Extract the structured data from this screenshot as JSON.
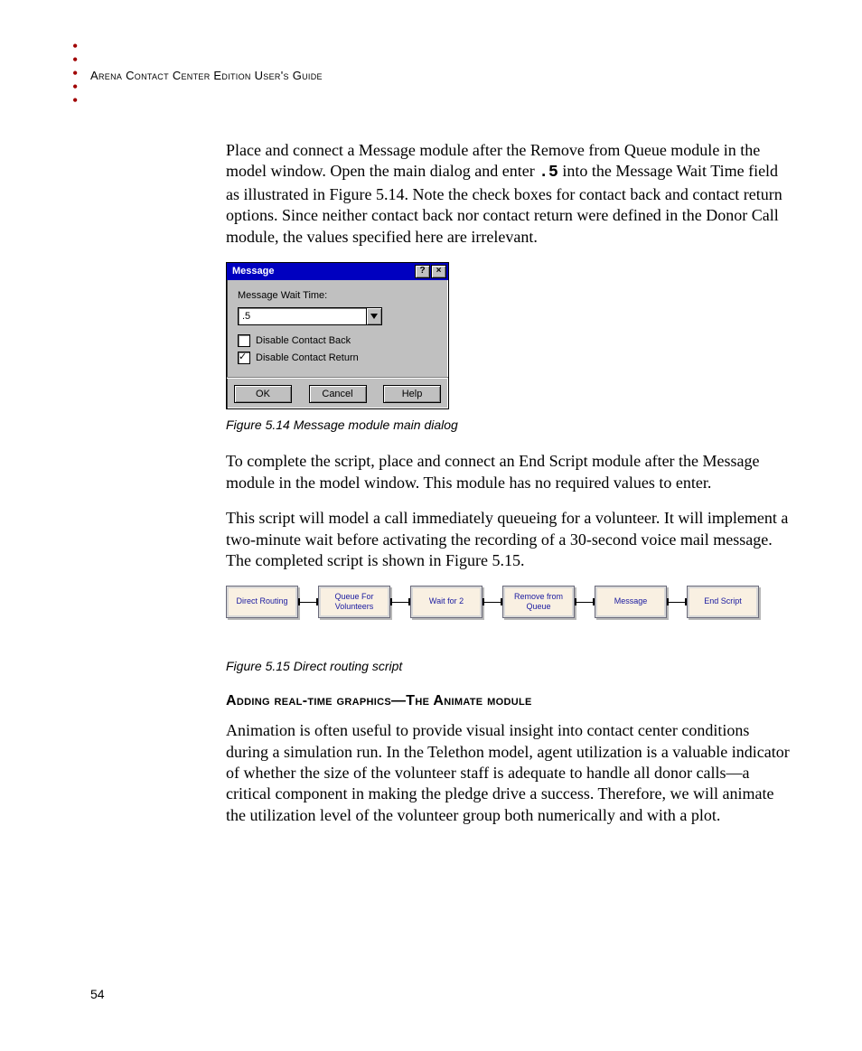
{
  "header": "Arena Contact Center Edition User's Guide",
  "page_number": "54",
  "paragraphs": {
    "p1_a": "Place and connect a Message module after the Remove from Queue module in the model window. Open the main dialog and enter ",
    "p1_code": ".5",
    "p1_b": " into the Message Wait Time field as illustrated in Figure 5.14. Note the check boxes for contact back and contact return options.  Since neither contact back nor contact return were defined in the Donor Call module, the values specified here are irrelevant.",
    "p2": "To complete the script, place and connect an End Script module after the Message module in the model window. This module has no required values to enter.",
    "p3": "This script will model a call immediately queueing for a volunteer. It will implement a two-minute wait before activating the recording of a 30-second voice mail message. The completed script is shown in Figure 5.15.",
    "p4": "Animation is often useful to provide visual insight into contact center conditions during a simulation run. In the Telethon model, agent utilization is a valuable indicator of whether the size of the volunteer staff is adequate to handle all donor calls—a critical component in making the pledge drive a success. Therefore, we will animate the utilization level of the volunteer group both numerically and with a plot."
  },
  "captions": {
    "fig514": "Figure 5.14 Message module main dialog",
    "fig515": "Figure 5.15 Direct routing script"
  },
  "section_heading": "Adding real-time graphics—The Animate module",
  "dialog": {
    "title": "Message",
    "field_label": "Message Wait Time:",
    "field_value": ".5",
    "check1": "Disable Contact Back",
    "check2": "Disable Contact Return",
    "btn_ok": "OK",
    "btn_cancel": "Cancel",
    "btn_help": "Help"
  },
  "flowchart": {
    "nodes": [
      "Direct Routing",
      "Queue For Volunteers",
      "Wait for 2",
      "Remove from Queue",
      "Message",
      "End Script"
    ]
  }
}
